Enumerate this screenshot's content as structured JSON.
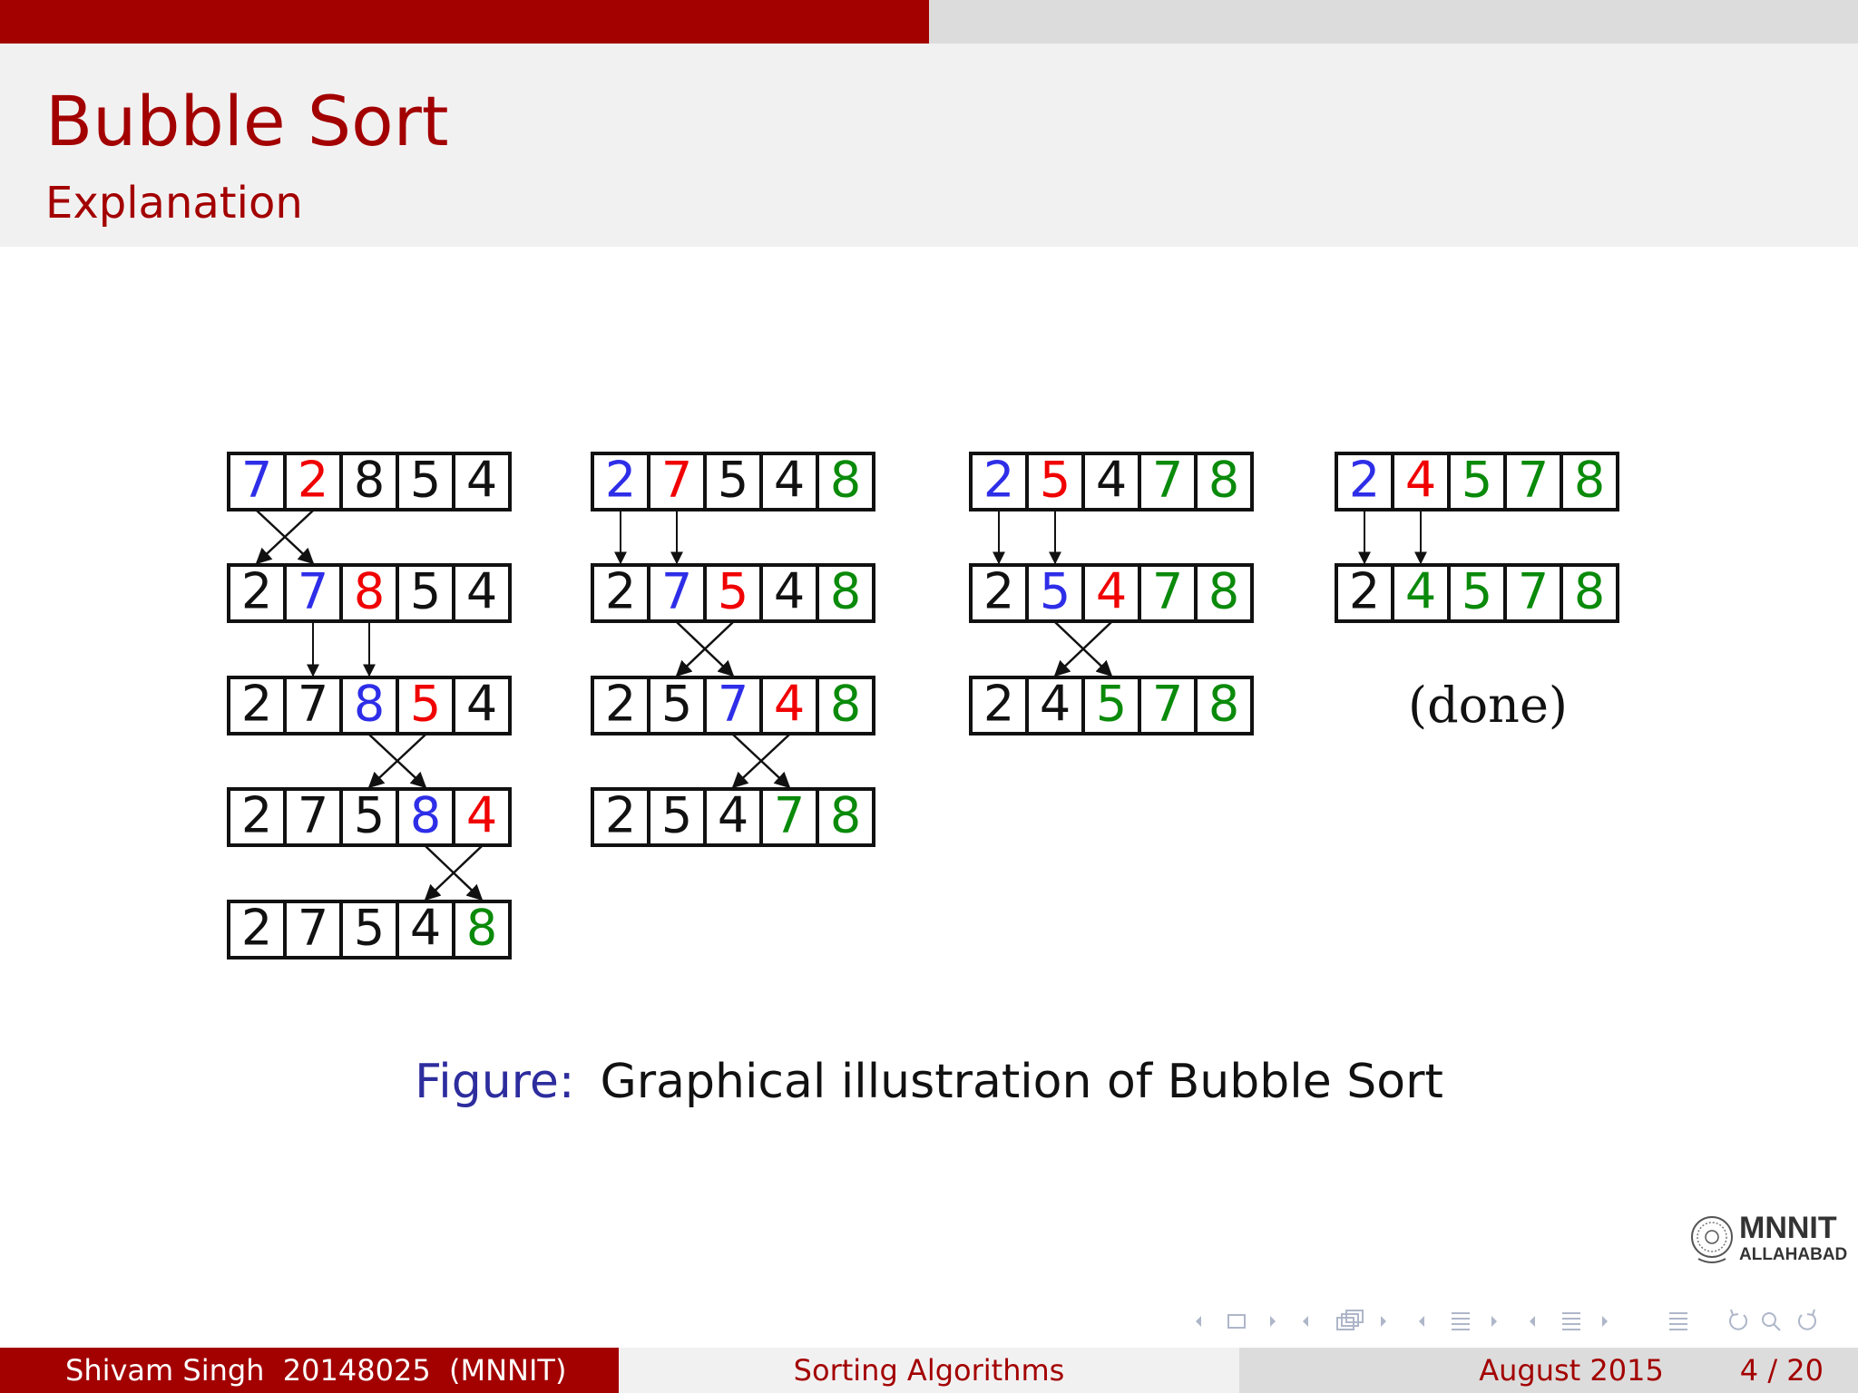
{
  "slide": {
    "title": "Bubble Sort",
    "subtitle": "Explanation",
    "progress": 0.5
  },
  "colors": {
    "brand": "#a30000",
    "blue": "#2e2ee8",
    "red": "#f00000",
    "green": "#0a8a0a",
    "black": "#111111"
  },
  "passes": [
    {
      "rows": [
        {
          "values": [
            "7",
            "2",
            "8",
            "5",
            "4"
          ],
          "colors": [
            "blue",
            "red",
            "black",
            "black",
            "black"
          ]
        },
        {
          "values": [
            "2",
            "7",
            "8",
            "5",
            "4"
          ],
          "colors": [
            "black",
            "blue",
            "red",
            "black",
            "black"
          ]
        },
        {
          "values": [
            "2",
            "7",
            "8",
            "5",
            "4"
          ],
          "colors": [
            "black",
            "black",
            "blue",
            "red",
            "black"
          ]
        },
        {
          "values": [
            "2",
            "7",
            "5",
            "8",
            "4"
          ],
          "colors": [
            "black",
            "black",
            "black",
            "blue",
            "red"
          ]
        },
        {
          "values": [
            "2",
            "7",
            "5",
            "4",
            "8"
          ],
          "colors": [
            "black",
            "black",
            "black",
            "black",
            "green"
          ]
        }
      ],
      "transitions": [
        "swap",
        "keep",
        "swap",
        "swap"
      ],
      "positions": [
        0,
        1,
        2,
        3
      ]
    },
    {
      "rows": [
        {
          "values": [
            "2",
            "7",
            "5",
            "4",
            "8"
          ],
          "colors": [
            "blue",
            "red",
            "black",
            "black",
            "green"
          ]
        },
        {
          "values": [
            "2",
            "7",
            "5",
            "4",
            "8"
          ],
          "colors": [
            "black",
            "blue",
            "red",
            "black",
            "green"
          ]
        },
        {
          "values": [
            "2",
            "5",
            "7",
            "4",
            "8"
          ],
          "colors": [
            "black",
            "black",
            "blue",
            "red",
            "green"
          ]
        },
        {
          "values": [
            "2",
            "5",
            "4",
            "7",
            "8"
          ],
          "colors": [
            "black",
            "black",
            "black",
            "green",
            "green"
          ]
        }
      ],
      "transitions": [
        "keep",
        "swap",
        "swap"
      ],
      "positions": [
        0,
        1,
        2
      ]
    },
    {
      "rows": [
        {
          "values": [
            "2",
            "5",
            "4",
            "7",
            "8"
          ],
          "colors": [
            "blue",
            "red",
            "black",
            "green",
            "green"
          ]
        },
        {
          "values": [
            "2",
            "5",
            "4",
            "7",
            "8"
          ],
          "colors": [
            "black",
            "blue",
            "red",
            "green",
            "green"
          ]
        },
        {
          "values": [
            "2",
            "4",
            "5",
            "7",
            "8"
          ],
          "colors": [
            "black",
            "black",
            "green",
            "green",
            "green"
          ]
        }
      ],
      "transitions": [
        "keep",
        "swap"
      ],
      "positions": [
        0,
        1
      ]
    },
    {
      "rows": [
        {
          "values": [
            "2",
            "4",
            "5",
            "7",
            "8"
          ],
          "colors": [
            "blue",
            "red",
            "green",
            "green",
            "green"
          ]
        },
        {
          "values": [
            "2",
            "4",
            "5",
            "7",
            "8"
          ],
          "colors": [
            "black",
            "green",
            "green",
            "green",
            "green"
          ]
        }
      ],
      "transitions": [
        "keep"
      ],
      "positions": [
        0
      ],
      "note": "(done)"
    }
  ],
  "caption": {
    "label": "Figure:",
    "text": "Graphical illustration of Bubble Sort"
  },
  "logo": {
    "main": "MNNIT",
    "sub": "ALLAHABAD"
  },
  "nav_icons": [
    "nav-frame-prev-icon",
    "nav-frame-icon",
    "nav-frame-next-icon",
    "nav-subsection-prev-icon",
    "nav-subsection-icon",
    "nav-subsection-next-icon",
    "nav-section-prev-icon",
    "nav-section-icon",
    "nav-section-next-icon",
    "nav-section-alt-prev-icon",
    "nav-section-alt-icon",
    "nav-section-alt-next-icon",
    "nav-toc-icon",
    "nav-back-icon",
    "nav-search-icon",
    "nav-forward-icon"
  ],
  "footer": {
    "author": "Shivam Singh  20148025  (MNNIT)",
    "title": "Sorting Algorithms",
    "date": "August 2015",
    "page": "4 / 20"
  }
}
